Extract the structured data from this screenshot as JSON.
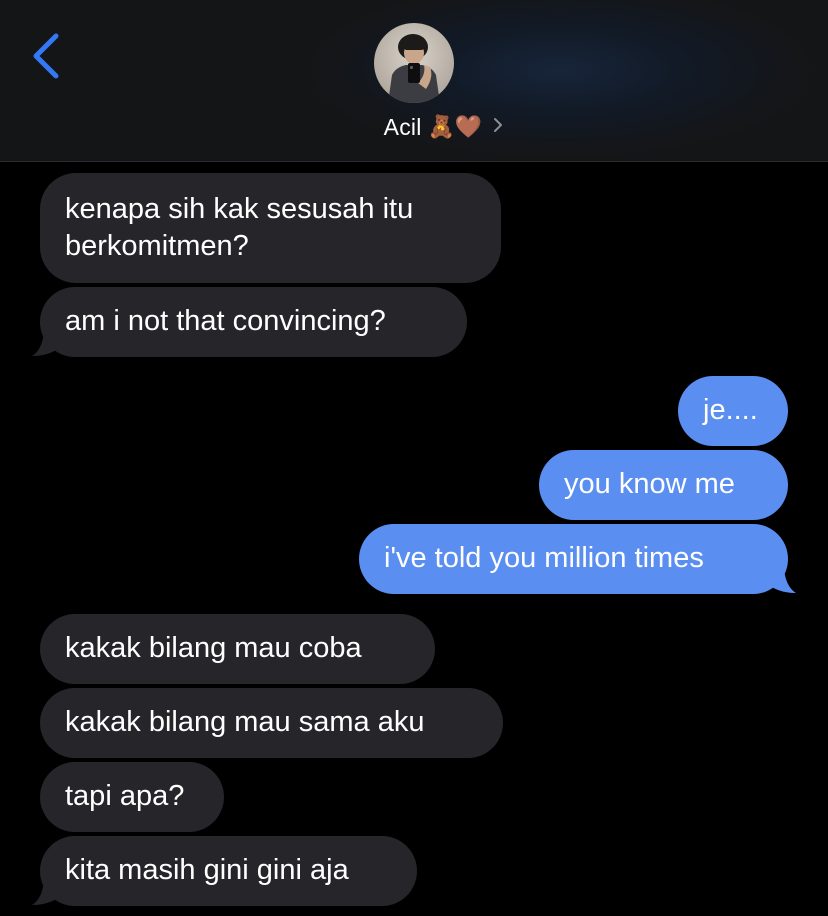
{
  "header": {
    "contact_name": "Acil",
    "contact_emoji": "🧸🤎"
  },
  "colors": {
    "accent": "#3478f6",
    "received_bubble": "#26262a",
    "sent_bubble": "#5a8ef0",
    "background": "#000000"
  },
  "messages": [
    {
      "direction": "received",
      "text_line1": "kenapa sih kak sesusah itu",
      "text_line2": "berkomitmen?"
    },
    {
      "direction": "received",
      "text": "am i not that convincing?"
    },
    {
      "direction": "sent",
      "text": "je...."
    },
    {
      "direction": "sent",
      "text": "you know me"
    },
    {
      "direction": "sent",
      "text": "i've told you million times"
    },
    {
      "direction": "received",
      "text": "kakak bilang mau coba"
    },
    {
      "direction": "received",
      "text": "kakak bilang mau sama aku"
    },
    {
      "direction": "received",
      "text": "tapi apa?"
    },
    {
      "direction": "received",
      "text": "kita masih gini gini aja"
    }
  ]
}
